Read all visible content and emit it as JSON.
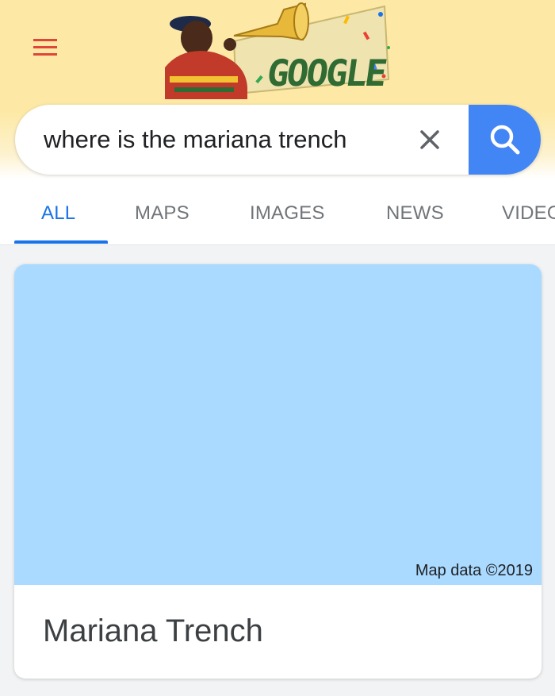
{
  "header": {
    "menu_icon": "hamburger-menu-icon",
    "doodle_alt": "Google doodle"
  },
  "search": {
    "query": "where is the mariana trench",
    "clear_icon": "close-icon",
    "search_icon": "search-icon",
    "accent": "#4285f4"
  },
  "tabs": [
    {
      "label": "ALL",
      "active": true
    },
    {
      "label": "MAPS",
      "active": false
    },
    {
      "label": "IMAGES",
      "active": false
    },
    {
      "label": "NEWS",
      "active": false
    },
    {
      "label": "VIDEOS",
      "active": false
    }
  ],
  "result": {
    "map_attribution": "Map data ©2019",
    "title": "Mariana Trench",
    "map_color": "#aadaff"
  }
}
